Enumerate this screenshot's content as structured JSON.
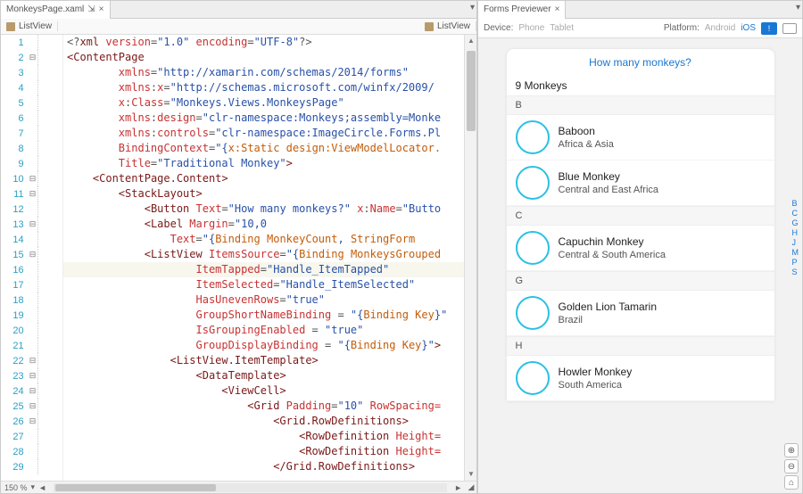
{
  "left": {
    "tab": {
      "title": "MonkeysPage.xaml",
      "pin": "⇲",
      "close": "×"
    },
    "breadcrumbs": [
      "ListView",
      "ListView"
    ],
    "zoom": "150 %",
    "code": [
      {
        "n": 1,
        "fold": "",
        "ind": 0,
        "seg": [
          [
            "<?",
            "t-pi"
          ],
          [
            "xml",
            "t-el"
          ],
          [
            " ",
            "t-pi"
          ],
          [
            "version",
            "t-attr"
          ],
          [
            "=",
            "t-pi"
          ],
          [
            "\"1.0\"",
            "t-val"
          ],
          [
            " ",
            "t-pi"
          ],
          [
            "encoding",
            "t-attr"
          ],
          [
            "=",
            "t-pi"
          ],
          [
            "\"UTF-8\"",
            "t-val"
          ],
          [
            "?>",
            "t-pi"
          ]
        ]
      },
      {
        "n": 2,
        "fold": "⊟",
        "ind": 0,
        "seg": [
          [
            "<",
            "t-el"
          ],
          [
            "ContentPage",
            "t-el"
          ]
        ]
      },
      {
        "n": 3,
        "fold": "",
        "ind": 2,
        "seg": [
          [
            "xmlns",
            "t-attr"
          ],
          [
            "=",
            "t-num"
          ],
          [
            "\"http://xamarin.com/schemas/2014/forms\"",
            "t-val"
          ]
        ]
      },
      {
        "n": 4,
        "fold": "",
        "ind": 2,
        "seg": [
          [
            "xmlns",
            "t-attr"
          ],
          [
            ":",
            "t-num"
          ],
          [
            "x",
            "t-attr"
          ],
          [
            "=",
            "t-num"
          ],
          [
            "\"http://schemas.microsoft.com/winfx/2009/",
            "t-val"
          ]
        ]
      },
      {
        "n": 5,
        "fold": "",
        "ind": 2,
        "seg": [
          [
            "x",
            "t-attr"
          ],
          [
            ":",
            "t-num"
          ],
          [
            "Class",
            "t-attr"
          ],
          [
            "=",
            "t-num"
          ],
          [
            "\"Monkeys.Views.MonkeysPage\"",
            "t-val"
          ]
        ]
      },
      {
        "n": 6,
        "fold": "",
        "ind": 2,
        "seg": [
          [
            "xmlns",
            "t-attr"
          ],
          [
            ":",
            "t-num"
          ],
          [
            "design",
            "t-attr"
          ],
          [
            "=",
            "t-num"
          ],
          [
            "\"clr-namespace:Monkeys;assembly=Monke",
            "t-val"
          ]
        ]
      },
      {
        "n": 7,
        "fold": "",
        "ind": 2,
        "seg": [
          [
            "xmlns",
            "t-attr"
          ],
          [
            ":",
            "t-num"
          ],
          [
            "controls",
            "t-attr"
          ],
          [
            "=",
            "t-num"
          ],
          [
            "\"clr-namespace:ImageCircle.Forms.Pl",
            "t-val"
          ]
        ]
      },
      {
        "n": 8,
        "fold": "",
        "ind": 2,
        "seg": [
          [
            "BindingContext",
            "t-attr"
          ],
          [
            "=",
            "t-num"
          ],
          [
            "\"{",
            "t-val"
          ],
          [
            "x:Static",
            "t-bind"
          ],
          [
            " ",
            "t-val"
          ],
          [
            "design:ViewModelLocator.",
            "t-bind"
          ]
        ]
      },
      {
        "n": 9,
        "fold": "",
        "ind": 2,
        "seg": [
          [
            "Title",
            "t-attr"
          ],
          [
            "=",
            "t-num"
          ],
          [
            "\"Traditional Monkey\"",
            "t-val"
          ],
          [
            ">",
            "t-el"
          ]
        ]
      },
      {
        "n": 10,
        "fold": "⊟",
        "ind": 1,
        "seg": [
          [
            "<",
            "t-el"
          ],
          [
            "ContentPage.Content",
            "t-el"
          ],
          [
            ">",
            "t-el"
          ]
        ]
      },
      {
        "n": 11,
        "fold": "⊟",
        "ind": 2,
        "seg": [
          [
            "<",
            "t-el"
          ],
          [
            "StackLayout",
            "t-el"
          ],
          [
            ">",
            "t-el"
          ]
        ]
      },
      {
        "n": 12,
        "fold": "",
        "ind": 3,
        "seg": [
          [
            "<",
            "t-el"
          ],
          [
            "Button",
            "t-el"
          ],
          [
            " ",
            "t-num"
          ],
          [
            "Text",
            "t-attr"
          ],
          [
            "=",
            "t-num"
          ],
          [
            "\"How many monkeys?\"",
            "t-val"
          ],
          [
            " ",
            "t-num"
          ],
          [
            "x",
            "t-attr"
          ],
          [
            ":",
            "t-num"
          ],
          [
            "Name",
            "t-attr"
          ],
          [
            "=",
            "t-num"
          ],
          [
            "\"Butto",
            "t-val"
          ]
        ]
      },
      {
        "n": 13,
        "fold": "⊟",
        "ind": 3,
        "seg": [
          [
            "<",
            "t-el"
          ],
          [
            "Label",
            "t-el"
          ],
          [
            " ",
            "t-num"
          ],
          [
            "Margin",
            "t-attr"
          ],
          [
            "=",
            "t-num"
          ],
          [
            "\"10,0",
            "t-val"
          ]
        ]
      },
      {
        "n": 14,
        "fold": "",
        "ind": 4,
        "seg": [
          [
            "Text",
            "t-attr"
          ],
          [
            "=",
            "t-num"
          ],
          [
            "\"{",
            "t-val"
          ],
          [
            "Binding",
            "t-bind"
          ],
          [
            " ",
            "t-val"
          ],
          [
            "MonkeyCount",
            "t-bind"
          ],
          [
            ", ",
            "t-val"
          ],
          [
            "StringForm",
            "t-bind"
          ]
        ]
      },
      {
        "n": 15,
        "fold": "⊟",
        "ind": 3,
        "seg": [
          [
            "<",
            "t-el"
          ],
          [
            "ListView",
            "t-el"
          ],
          [
            " ",
            "t-num"
          ],
          [
            "ItemsSource",
            "t-attr"
          ],
          [
            "=",
            "t-num"
          ],
          [
            "\"{",
            "t-val"
          ],
          [
            "Binding",
            "t-bind"
          ],
          [
            " ",
            "t-val"
          ],
          [
            "MonkeysGrouped",
            "t-bind"
          ]
        ]
      },
      {
        "n": 16,
        "fold": "",
        "ind": 5,
        "hl": true,
        "seg": [
          [
            "ItemTapped",
            "t-attr"
          ],
          [
            "=",
            "t-num"
          ],
          [
            "\"Handle_ItemTapped\"",
            "t-val"
          ]
        ]
      },
      {
        "n": 17,
        "fold": "",
        "ind": 5,
        "seg": [
          [
            "ItemSelected",
            "t-attr"
          ],
          [
            "=",
            "t-num"
          ],
          [
            "\"Handle_ItemSelected\"",
            "t-val"
          ]
        ]
      },
      {
        "n": 18,
        "fold": "",
        "ind": 5,
        "seg": [
          [
            "HasUnevenRows",
            "t-attr"
          ],
          [
            "=",
            "t-num"
          ],
          [
            "\"true\"",
            "t-val"
          ]
        ]
      },
      {
        "n": 19,
        "fold": "",
        "ind": 5,
        "seg": [
          [
            "GroupShortNameBinding",
            "t-attr"
          ],
          [
            " = ",
            "t-num"
          ],
          [
            "\"{",
            "t-val"
          ],
          [
            "Binding",
            "t-bind"
          ],
          [
            " ",
            "t-val"
          ],
          [
            "Key",
            "t-bind"
          ],
          [
            "}\"",
            "t-val"
          ]
        ]
      },
      {
        "n": 20,
        "fold": "",
        "ind": 5,
        "seg": [
          [
            "IsGroupingEnabled",
            "t-attr"
          ],
          [
            " = ",
            "t-num"
          ],
          [
            "\"true\"",
            "t-val"
          ]
        ]
      },
      {
        "n": 21,
        "fold": "",
        "ind": 5,
        "seg": [
          [
            "GroupDisplayBinding",
            "t-attr"
          ],
          [
            " = ",
            "t-num"
          ],
          [
            "\"{",
            "t-val"
          ],
          [
            "Binding",
            "t-bind"
          ],
          [
            " ",
            "t-val"
          ],
          [
            "Key",
            "t-bind"
          ],
          [
            "}\"",
            "t-val"
          ],
          [
            ">",
            "t-el"
          ]
        ]
      },
      {
        "n": 22,
        "fold": "⊟",
        "ind": 4,
        "seg": [
          [
            "<",
            "t-el"
          ],
          [
            "ListView.ItemTemplate",
            "t-el"
          ],
          [
            ">",
            "t-el"
          ]
        ]
      },
      {
        "n": 23,
        "fold": "⊟",
        "ind": 5,
        "seg": [
          [
            "<",
            "t-el"
          ],
          [
            "DataTemplate",
            "t-el"
          ],
          [
            ">",
            "t-el"
          ]
        ]
      },
      {
        "n": 24,
        "fold": "⊟",
        "ind": 6,
        "seg": [
          [
            "<",
            "t-el"
          ],
          [
            "ViewCell",
            "t-el"
          ],
          [
            ">",
            "t-el"
          ]
        ]
      },
      {
        "n": 25,
        "fold": "⊟",
        "ind": 7,
        "seg": [
          [
            "<",
            "t-el"
          ],
          [
            "Grid",
            "t-el"
          ],
          [
            " ",
            "t-num"
          ],
          [
            "Padding",
            "t-attr"
          ],
          [
            "=",
            "t-num"
          ],
          [
            "\"10\"",
            "t-val"
          ],
          [
            " ",
            "t-num"
          ],
          [
            "RowSpacing=",
            "t-attr"
          ]
        ]
      },
      {
        "n": 26,
        "fold": "⊟",
        "ind": 8,
        "seg": [
          [
            "<",
            "t-el"
          ],
          [
            "Grid.RowDefinitions",
            "t-el"
          ],
          [
            ">",
            "t-el"
          ]
        ]
      },
      {
        "n": 27,
        "fold": "",
        "ind": 9,
        "seg": [
          [
            "<",
            "t-el"
          ],
          [
            "RowDefinition",
            "t-el"
          ],
          [
            " ",
            "t-num"
          ],
          [
            "Height=",
            "t-attr"
          ]
        ]
      },
      {
        "n": 28,
        "fold": "",
        "ind": 9,
        "seg": [
          [
            "<",
            "t-el"
          ],
          [
            "RowDefinition",
            "t-el"
          ],
          [
            " ",
            "t-num"
          ],
          [
            "Height=",
            "t-attr"
          ]
        ]
      },
      {
        "n": 29,
        "fold": "",
        "ind": 8,
        "seg": [
          [
            "</Grid.RowDefinitions>",
            "t-el"
          ]
        ]
      }
    ]
  },
  "right": {
    "tab": {
      "title": "Forms Previewer",
      "close": "×"
    },
    "device_label": "Device:",
    "device_phone": "Phone",
    "device_tablet": "Tablet",
    "platform_label": "Platform:",
    "platform_android": "Android",
    "platform_ios": "iOS",
    "nav_title": "How many monkeys?",
    "count": "9 Monkeys",
    "groups": [
      {
        "key": "B",
        "items": [
          {
            "name": "Baboon",
            "loc": "Africa & Asia"
          },
          {
            "name": "Blue Monkey",
            "loc": "Central and East Africa"
          }
        ]
      },
      {
        "key": "C",
        "items": [
          {
            "name": "Capuchin Monkey",
            "loc": "Central & South America"
          }
        ]
      },
      {
        "key": "G",
        "items": [
          {
            "name": "Golden Lion Tamarin",
            "loc": "Brazil"
          }
        ]
      },
      {
        "key": "H",
        "items": [
          {
            "name": "Howler Monkey",
            "loc": "South America"
          }
        ]
      }
    ],
    "index_letters": [
      "B",
      "C",
      "G",
      "H",
      "J",
      "M",
      "P",
      "S"
    ],
    "zoom_controls": [
      "⊕",
      "⊖",
      "⌂"
    ]
  }
}
